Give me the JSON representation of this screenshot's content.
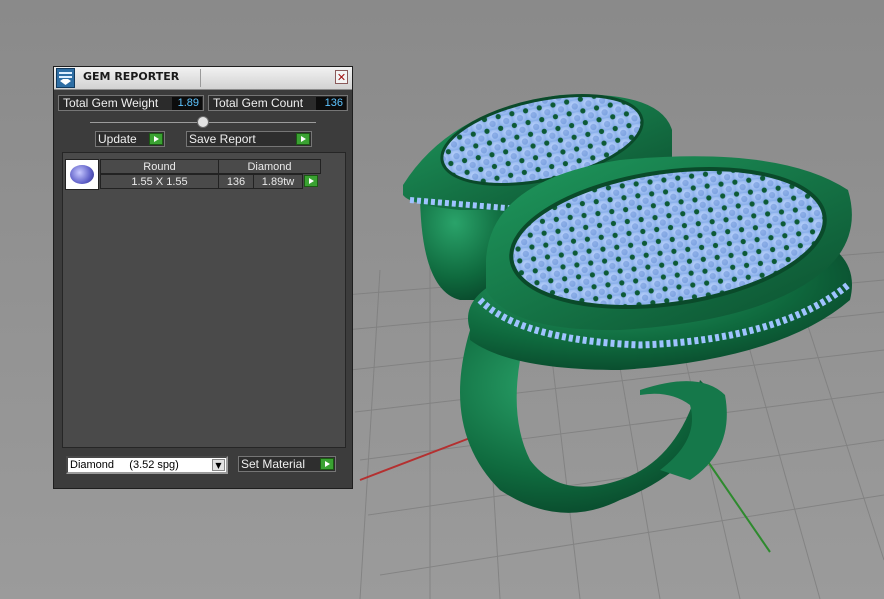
{
  "panel": {
    "title": "GEM REPORTER",
    "close_glyph": "✕",
    "app_icon": "gem-reporter-icon"
  },
  "stats": {
    "weight_label": "Total Gem Weight",
    "weight_value": "1.89",
    "count_label": "Total Gem Count",
    "count_value": "136"
  },
  "actions": {
    "update_label": "Update",
    "save_report_label": "Save Report"
  },
  "gem_rows": [
    {
      "shape": "Round",
      "material": "Diamond",
      "size": "1.55 X 1.55",
      "count": "136",
      "total_weight": "1.89tw"
    }
  ],
  "material": {
    "selected": "Diamond     (3.52 spg)",
    "set_label": "Set Material"
  },
  "colors": {
    "accent_green": "#3aa232",
    "value_blue": "#5ec4ff",
    "ring_green": "#0f6a3e",
    "gem_blue": "#a9c8ff",
    "viewport_bg": "#8e8e8e"
  }
}
